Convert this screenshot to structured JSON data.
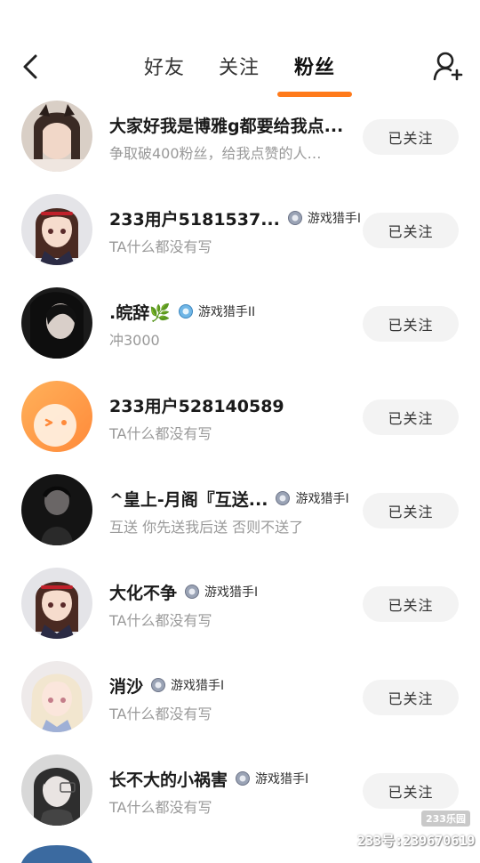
{
  "header": {
    "tabs": [
      {
        "label": "好友",
        "selected": false
      },
      {
        "label": "关注",
        "selected": false
      },
      {
        "label": "粉丝",
        "selected": true
      }
    ],
    "accent_color": "#ff7a1a"
  },
  "followers": [
    {
      "name": "大家好我是博雅g都要给我点...",
      "badge": "",
      "subtitle": "争取破400粉丝，给我点赞的人…",
      "button": "已关注"
    },
    {
      "name": "233用户5181537...",
      "badge": "游戏猎手I",
      "subtitle": "TA什么都没有写",
      "button": "已关注"
    },
    {
      "name": ".皖辞🌿",
      "badge": "游戏猎手II",
      "subtitle": "冲3000",
      "button": "已关注"
    },
    {
      "name": "233用户528140589",
      "badge": "",
      "subtitle": "TA什么都没有写",
      "button": "已关注"
    },
    {
      "name": "^皇上-月阁『互送...",
      "badge": "游戏猎手I",
      "subtitle": "互送 你先送我后送 否则不送了",
      "button": "已关注"
    },
    {
      "name": "大化不争",
      "badge": "游戏猎手I",
      "subtitle": "TA什么都没有写",
      "button": "已关注"
    },
    {
      "name": "消沙",
      "badge": "游戏猎手I",
      "subtitle": "TA什么都没有写",
      "button": "已关注"
    },
    {
      "name": "长不大的小祸害",
      "badge": "游戏猎手I",
      "subtitle": "TA什么都没有写",
      "button": "已关注"
    }
  ],
  "watermark": {
    "logo": "233乐园",
    "id_text": "233号:239670619"
  }
}
